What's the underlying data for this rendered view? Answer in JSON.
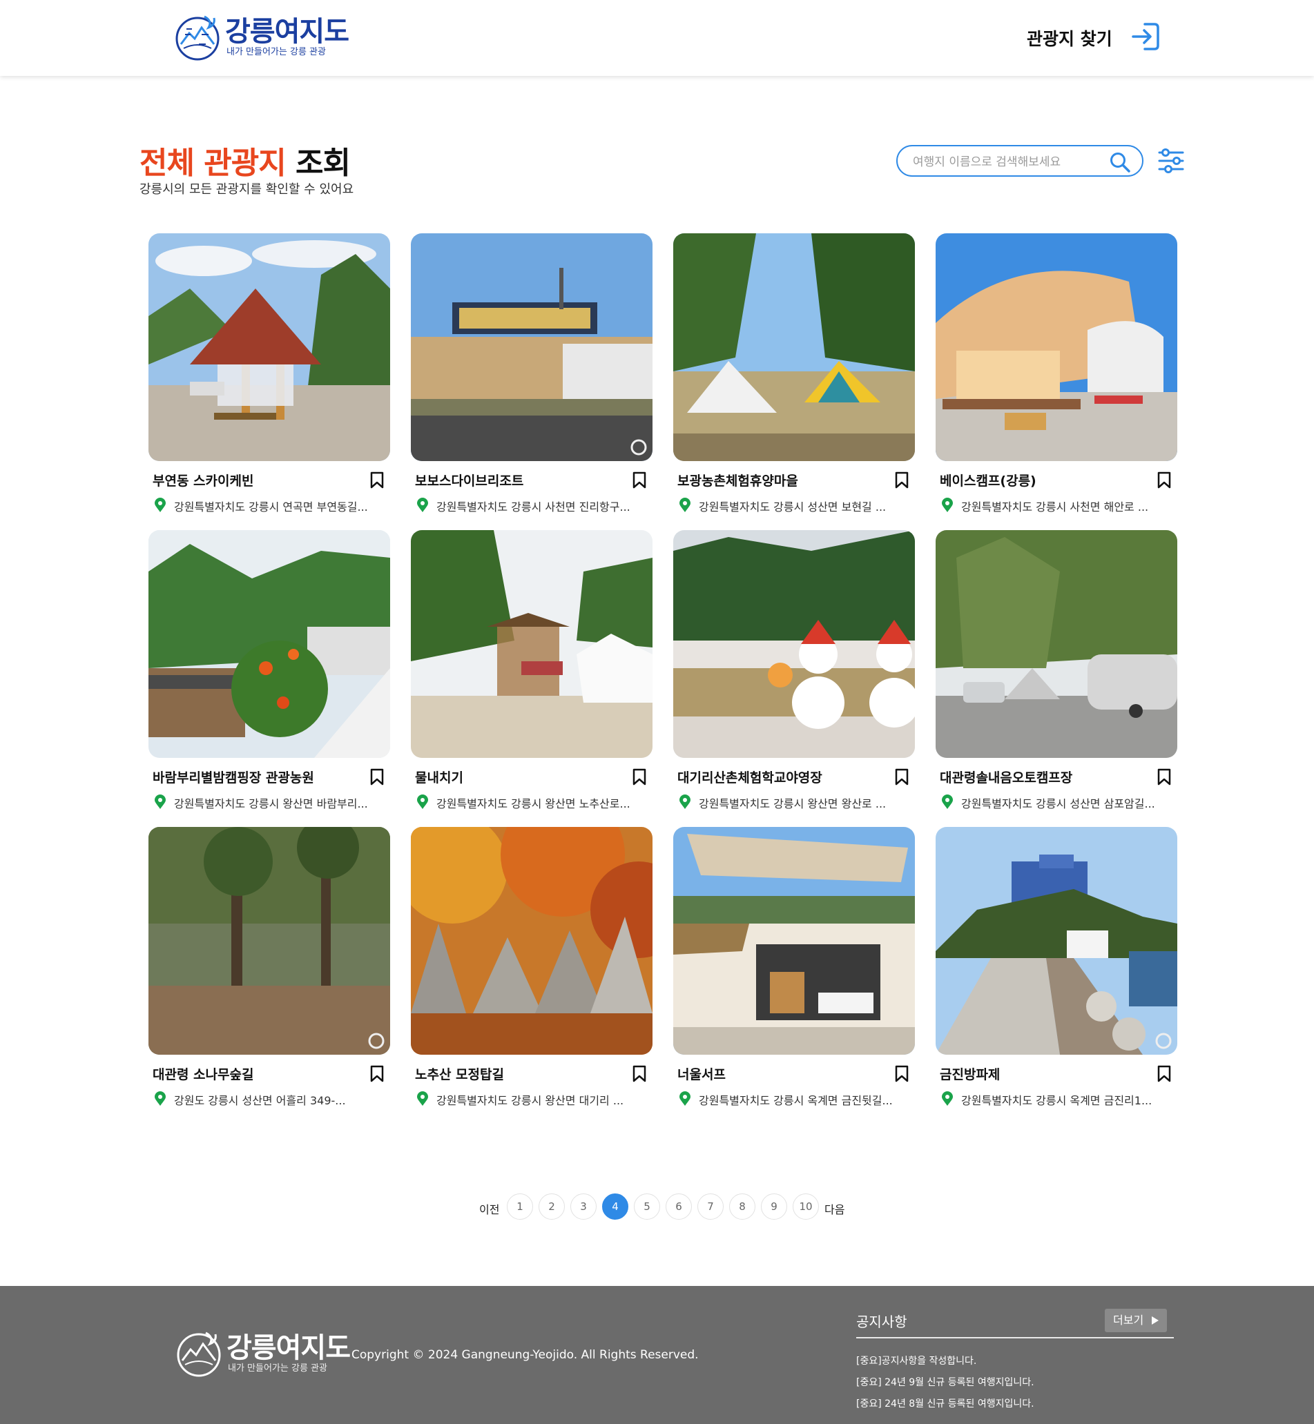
{
  "header": {
    "logo_title": "강릉여지도",
    "logo_subtitle": "내가 만들어가는 강릉 관광",
    "nav_find": "관광지 찾기",
    "login_icon": "login-arrow-icon"
  },
  "title_section": {
    "title_accent": "전체 관광지",
    "title_rest": "조회",
    "description": "강릉시의 모든 관광지를 확인할 수 있어요",
    "search_placeholder": "여행지 이름으로 검색해보세요",
    "search_icon": "search-icon",
    "filter_icon": "filter-sliders-icon"
  },
  "places": [
    {
      "name": "부연동 스카이케빈",
      "address": "강원특별자치도 강릉시 연곡면 부연동길..."
    },
    {
      "name": "보보스다이브리조트",
      "address": "강원특별자치도 강릉시 사천면 진리항구..."
    },
    {
      "name": "보광농촌체험휴양마을",
      "address": "강원특별자치도 강릉시 성산면 보현길 ..."
    },
    {
      "name": "베이스캠프(강릉)",
      "address": "강원특별자치도 강릉시 사천면 해안로 ..."
    },
    {
      "name": "바람부리별밤캠핑장 관광농원",
      "address": "강원특별자치도 강릉시 왕산면 바람부리..."
    },
    {
      "name": "물내치기",
      "address": "강원특별자치도 강릉시 왕산면 노추산로..."
    },
    {
      "name": "대기리산촌체험학교야영장",
      "address": "강원특별자치도 강릉시 왕산면 왕산로 ..."
    },
    {
      "name": "대관령솔내음오토캠프장",
      "address": "강원특별자치도 강릉시 성산면 삼포암길..."
    },
    {
      "name": "대관령 소나무숲길",
      "address": "강원도 강릉시 성산면 어흘리 349-..."
    },
    {
      "name": "노추산 모정탑길",
      "address": "강원특별자치도 강릉시 왕산면 대기리 ..."
    },
    {
      "name": "너울서프",
      "address": "강원특별자치도 강릉시 옥계면 금진뒷길..."
    },
    {
      "name": "금진방파제",
      "address": "강원특별자치도 강릉시 옥계면 금진리1..."
    }
  ],
  "pagination": {
    "prev": "이전",
    "next": "다음",
    "pages": [
      "1",
      "2",
      "3",
      "4",
      "5",
      "6",
      "7",
      "8",
      "9",
      "10"
    ],
    "current": "4"
  },
  "footer": {
    "logo_title": "강릉여지도",
    "logo_subtitle": "내가 만들어가는 강릉 관광",
    "copyright": "Copyright © 2024 Gangneung-Yeojido. All Rights Reserved.",
    "notice_title": "공지사항",
    "more_label": "더보기",
    "notices": [
      "[중요]공지사항을 작성합니다.",
      "[중요] 24년 9월 신규 등록된 여행지입니다.",
      "[중요] 24년 8월 신규 등록된 여행지입니다."
    ]
  },
  "colors": {
    "accent": "#e8461e",
    "primary": "#2f8ae6",
    "logo_blue": "#1b3fa0",
    "pin_green": "#1aa34a",
    "footer_bg": "#6b6b6b"
  }
}
